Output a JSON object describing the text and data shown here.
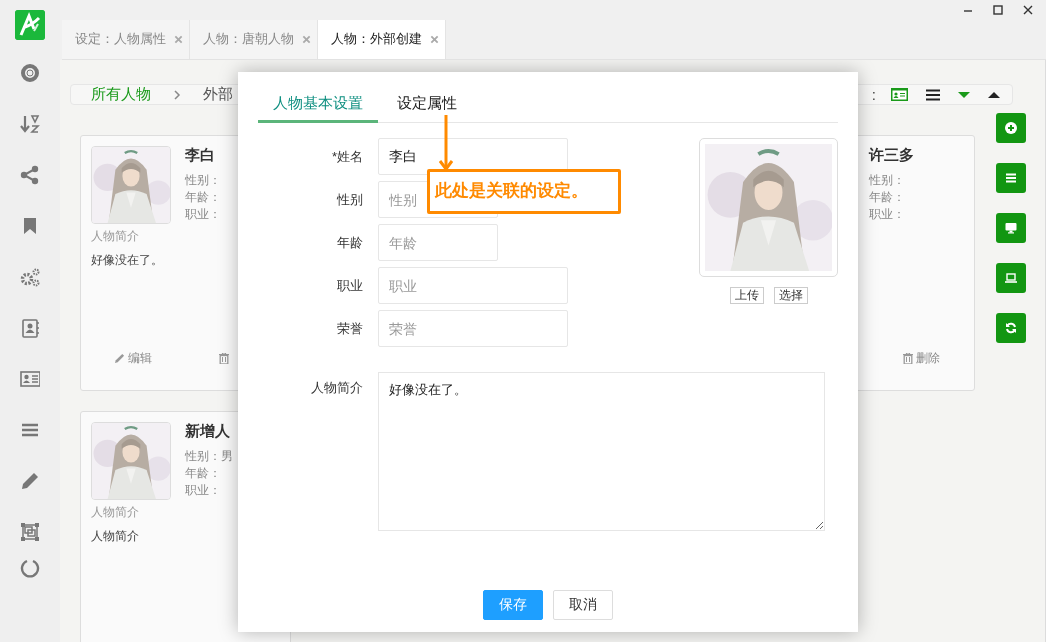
{
  "tabs": [
    {
      "label": "设定：人物属性",
      "selected": false
    },
    {
      "label": "人物：唐朝人物",
      "selected": false
    },
    {
      "label": "人物：外部创建",
      "selected": true
    }
  ],
  "breadcrumb": {
    "items": [
      "所有人物",
      "外部"
    ],
    "toolbar_tail": ":"
  },
  "cards": [
    {
      "name": "李白",
      "avatar": {
        "kind": "picture"
      },
      "fields": [
        "性别：",
        "年龄：",
        "职业："
      ],
      "intro_label": "人物简介",
      "intro": "好像没在了。",
      "actions": [
        {
          "kind": "edit",
          "label": "编辑"
        },
        {
          "kind": "delete"
        }
      ]
    },
    {
      "name": "许三多",
      "fields": [
        "性别：",
        "年龄：",
        "职业："
      ],
      "actions": [
        {
          "kind": "delete",
          "label": "删除"
        }
      ]
    },
    {
      "name": "新增人",
      "avatar": {
        "kind": "picture"
      },
      "fields": [
        "性别：男",
        "年龄：",
        "职业："
      ],
      "intro_label": "人物简介",
      "intro": "人物简介"
    }
  ],
  "modal": {
    "tabs": [
      {
        "label": "人物基本设置",
        "selected": true
      },
      {
        "label": "设定属性",
        "selected": false
      }
    ],
    "fields": [
      {
        "label": "*姓名",
        "value": "李白"
      },
      {
        "label": "性别",
        "placeholder": "性别"
      },
      {
        "label": "年龄",
        "placeholder": "年龄"
      },
      {
        "label": "职业",
        "placeholder": "职业"
      },
      {
        "label": "荣誉",
        "placeholder": "荣誉"
      }
    ],
    "intro": {
      "label": "人物简介",
      "value": "好像没在了。"
    },
    "photo": {
      "kind": "picture",
      "buttons": [
        "上传",
        "选择"
      ]
    },
    "buttons": [
      {
        "kind": "primary",
        "label": "保存"
      },
      {
        "kind": "default",
        "label": "取消"
      }
    ]
  },
  "annotation": {
    "text": "此处是关联的设定。"
  }
}
